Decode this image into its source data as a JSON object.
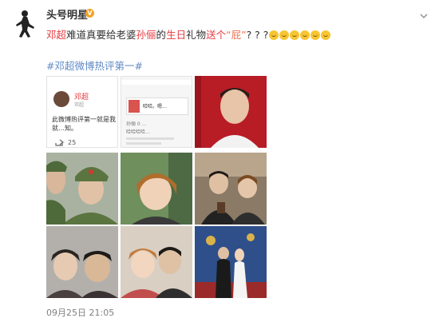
{
  "author": {
    "name": "头号明星",
    "verified_badge": "V",
    "avatar": "silhouette-avatar"
  },
  "post": {
    "parts": [
      {
        "text": "邓超",
        "color": "red"
      },
      {
        "text": "难道真要给老婆",
        "color": "normal"
      },
      {
        "text": "孙俪",
        "color": "red"
      },
      {
        "text": "的",
        "color": "normal"
      },
      {
        "text": "生日",
        "color": "red"
      },
      {
        "text": "礼物",
        "color": "normal"
      },
      {
        "text": "送个",
        "color": "red"
      },
      {
        "text": "“屁”",
        "color": "orange"
      },
      {
        "text": "? ? ?",
        "color": "normal"
      }
    ],
    "emoji_count": 6,
    "hashtag": "#邓超微博热评第一#"
  },
  "images": {
    "screenshot1": {
      "name": "邓超",
      "sub": "邓超",
      "text": "此微博热评第一就是我就…知。",
      "forward_count": "25"
    },
    "screenshot2": {
      "box_text": "哈哈。嗯…",
      "lines": [
        "孙俪 0 ...",
        "哈哈哈哈..."
      ]
    }
  },
  "timestamp": "09月25日 21:05",
  "colors": {
    "accent_red": "#e8393f",
    "accent_orange": "#eb7350",
    "link_blue": "#5f8ac5",
    "timestamp_gray": "#808080"
  }
}
